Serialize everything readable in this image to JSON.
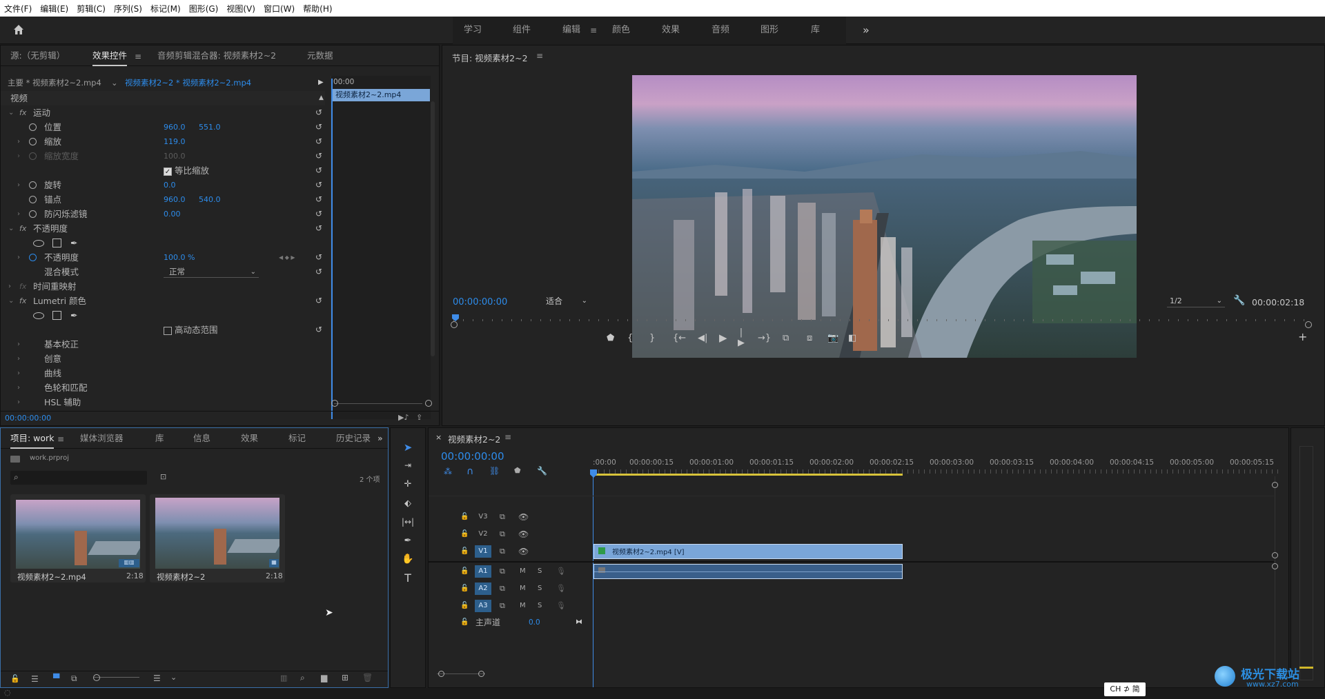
{
  "menubar": {
    "items": [
      "文件(F)",
      "编辑(E)",
      "剪辑(C)",
      "序列(S)",
      "标记(M)",
      "图形(G)",
      "视图(V)",
      "窗口(W)",
      "帮助(H)"
    ]
  },
  "workspaces": {
    "items": [
      "学习",
      "组件",
      "编辑",
      "颜色",
      "效果",
      "音频",
      "图形",
      "库"
    ],
    "active": "编辑",
    "more": "»"
  },
  "source_panel": {
    "tabs": [
      "源:（无剪辑）",
      "效果控件",
      "音频剪辑混合器: 视频素材2~2",
      "元数据"
    ],
    "active_tab": "效果控件",
    "clip_master": "主要 * 视频素材2~2.mp4",
    "clip_selected": "视频素材2~2 * 视频素材2~2.mp4",
    "mini_timecode": "00:00",
    "mini_clip": "视频素材2~2.mp4",
    "section_video": "视频",
    "rows": {
      "motion": "运动",
      "position": "位置",
      "position_x": "960.0",
      "position_y": "551.0",
      "scale": "缩放",
      "scale_v": "119.0",
      "scale_width": "缩放宽度",
      "scale_width_v": "100.0",
      "uniform_scale": "等比缩放",
      "rotation": "旋转",
      "rotation_v": "0.0",
      "anchor": "锚点",
      "anchor_x": "960.0",
      "anchor_y": "540.0",
      "flicker": "防闪烁滤镜",
      "flicker_v": "0.00",
      "opacity_group": "不透明度",
      "opacity": "不透明度",
      "opacity_v": "100.0 %",
      "blend_mode": "混合模式",
      "blend_mode_v": "正常",
      "time_remap": "时间重映射",
      "lumetri": "Lumetri 颜色",
      "hdr": "高动态范围",
      "basic": "基本校正",
      "creative": "创意",
      "curves": "曲线",
      "color_wheels": "色轮和匹配",
      "hsl": "HSL 辅助"
    },
    "fx_label": "fx",
    "footer_timecode": "00:00:00:00"
  },
  "program_monitor": {
    "title": "节目: 视频素材2~2",
    "timecode": "00:00:00:00",
    "fit": "适合",
    "resolution": "1/2",
    "duration": "00:00:02:18"
  },
  "project_panel": {
    "tabs": [
      "项目: work",
      "媒体浏览器",
      "库",
      "信息",
      "效果",
      "标记",
      "历史记录"
    ],
    "active_tab": "项目: work",
    "file": "work.prproj",
    "count": "2 个项",
    "search_placeholder": "",
    "items": [
      {
        "name": "视频素材2~2.mp4",
        "duration": "2:18"
      },
      {
        "name": "视频素材2~2",
        "duration": "2:18"
      }
    ]
  },
  "timeline": {
    "title": "视频素材2~2",
    "timecode": "00:00:00:00",
    "ruler": [
      ":00:00",
      "00:00:00:15",
      "00:00:01:00",
      "00:00:01:15",
      "00:00:02:00",
      "00:00:02:15",
      "00:00:03:00",
      "00:00:03:15",
      "00:00:04:00",
      "00:00:04:15",
      "00:00:05:00",
      "00:00:05:15"
    ],
    "video_tracks": [
      "V3",
      "V2",
      "V1"
    ],
    "audio_tracks": [
      "A1",
      "A2",
      "A3"
    ],
    "master": "主声道",
    "master_value": "0.0",
    "clip_label": "视频素材2~2.mp4 [V]",
    "m_label": "M",
    "s_label": "S"
  },
  "ime": "CH ⊅ 简",
  "watermark": "极光下载站",
  "watermark_url": "www.xz7.com",
  "colors": {
    "accent": "#2d8ceb",
    "clip_video": "#7aa6d8",
    "clip_audio": "#3a5f8a",
    "playhead": "#3f8ce8",
    "work_area": "#d8c33a"
  }
}
